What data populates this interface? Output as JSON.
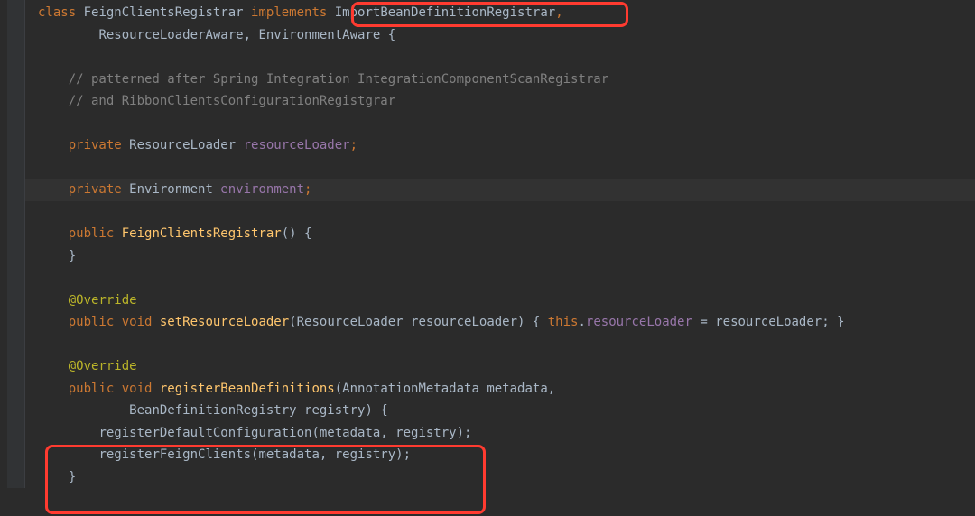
{
  "code": {
    "topComment": "*/",
    "line1_class": "class",
    "line1_name": " FeignClientsRegistrar ",
    "line1_implements": "implements ",
    "line1_interface1": "ImportBeanDefinitionRegistrar",
    "line1_comma": ",",
    "line2_interfaces": "ResourceLoaderAware, EnvironmentAware {",
    "line3_comment": "// patterned after Spring Integration IntegrationComponentScanRegistrar",
    "line4_comment": "// and RibbonClientsConfigurationRegistgrar",
    "line5_private": "private",
    "line5_type": " ResourceLoader ",
    "line5_field": "resourceLoader",
    "line5_semi": ";",
    "line6_private": "private",
    "line6_type": " Environment ",
    "line6_field": "environment",
    "line6_semi": ";",
    "line7_public": "public",
    "line7_constructor": " FeignClientsRegistrar",
    "line7_parens": "() {",
    "line8_brace": "}",
    "line9_annotation": "@Override",
    "line10_public": "public",
    "line10_void": " void ",
    "line10_method": "setResourceLoader",
    "line10_params": "(ResourceLoader resourceLoader) { ",
    "line10_this": "this",
    "line10_dot": ".",
    "line10_field": "resourceLoader",
    "line10_assign": " = resourceLoader; }",
    "line11_annotation": "@Override",
    "line12_public": "public",
    "line12_void": " void ",
    "line12_method": "registerBeanDefinitions",
    "line12_params": "(AnnotationMetadata metadata,",
    "line13_params": "BeanDefinitionRegistry registry) {",
    "line14_call": "registerDefaultConfiguration(metadata, registry);",
    "line15_call": "registerFeignClients(metadata, registry);",
    "line16_brace": "}"
  }
}
